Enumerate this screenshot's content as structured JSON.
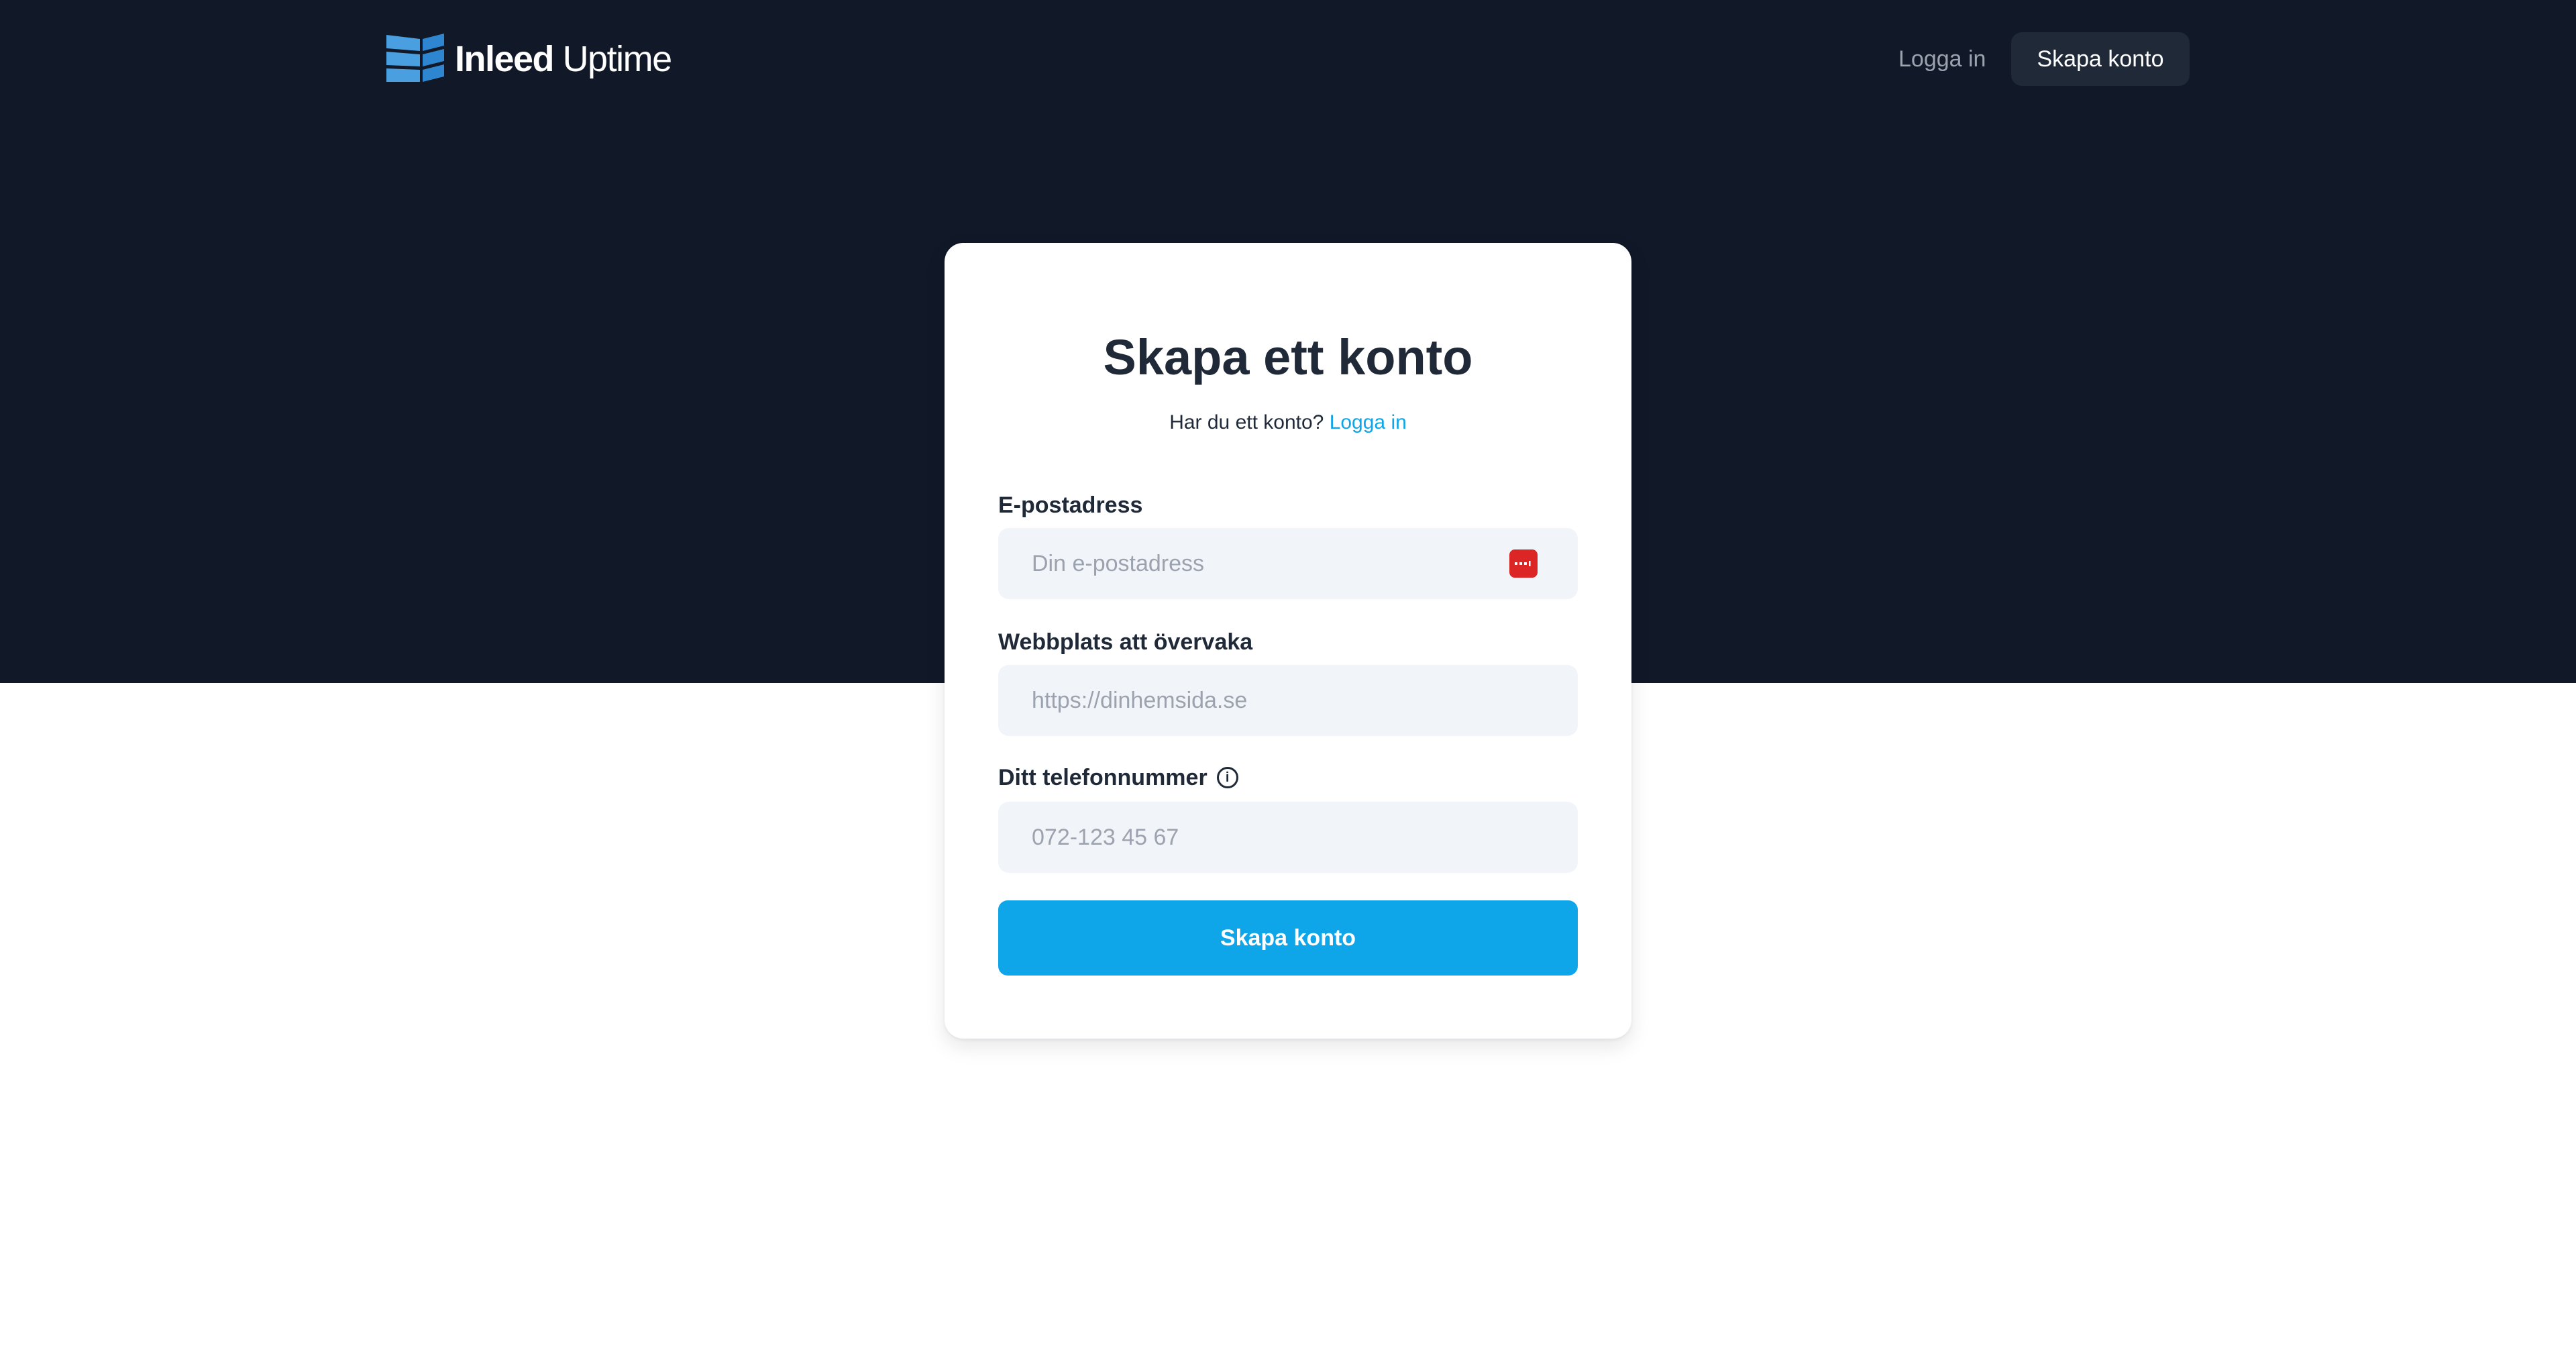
{
  "brand": {
    "name_strong": "Inleed",
    "name_light": "Uptime",
    "logo_icon": "stacked-blocks-icon",
    "accent": "#0ea5e9",
    "dark_bg": "#111827"
  },
  "nav": {
    "login_label": "Logga in",
    "signup_label": "Skapa konto"
  },
  "form": {
    "title": "Skapa ett konto",
    "subtitle_prefix": "Har du ett konto?",
    "subtitle_link": "Logga in",
    "email": {
      "label": "E-postadress",
      "placeholder": "Din e-postadress",
      "value": "",
      "badge_icon": "password-manager-icon"
    },
    "website": {
      "label": "Webbplats att övervaka",
      "placeholder": "https://dinhemsida.se",
      "value": ""
    },
    "phone": {
      "label": "Ditt telefonnummer",
      "placeholder": "072-123 45 67",
      "value": "",
      "info_icon": "info-icon"
    },
    "submit_label": "Skapa konto"
  }
}
